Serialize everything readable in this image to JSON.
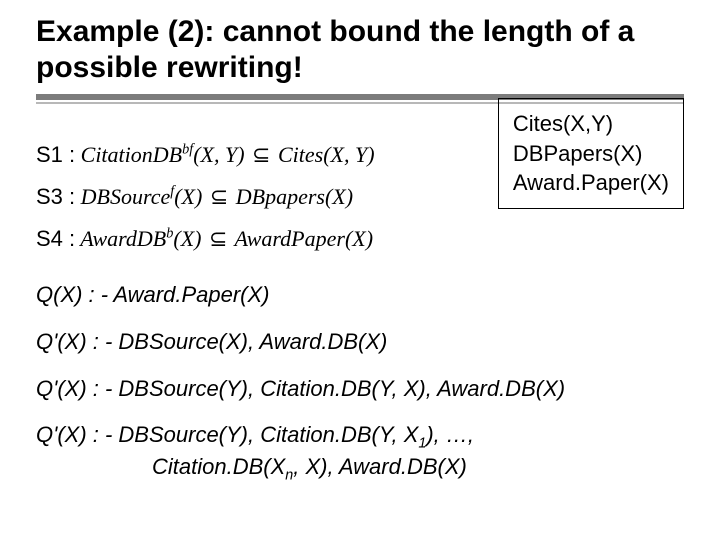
{
  "title": "Example (2): cannot bound the length of a possible rewriting!",
  "schema": {
    "line1": "Cites(X,Y)",
    "line2": "DBPapers(X)",
    "line3": "Award.Paper(X)"
  },
  "rules": {
    "s1": {
      "label": "S1 :",
      "lhs_name": "CitationDB",
      "lhs_sup": "bf",
      "lhs_args": "(X, Y)",
      "rhs": "Cites(X, Y)"
    },
    "s3": {
      "label": "S3 :",
      "lhs_name": "DBSource",
      "lhs_sup": "f",
      "lhs_args": "(X)",
      "rhs": "DBpapers(X)"
    },
    "s4": {
      "label": "S4 :",
      "lhs_name": "AwardDB",
      "lhs_sup": "b",
      "lhs_args": "(X)",
      "rhs": "AwardPaper(X)"
    }
  },
  "queries": {
    "q0": "Q(X) : -  Award.Paper(X)",
    "q1": "Q'(X) : -  DBSource(X), Award.DB(X)",
    "q2": "Q'(X) : -  DBSource(Y), Citation.DB(Y, X), Award.DB(X)",
    "q3_part1": "Q'(X) : -  DBSource(Y), Citation.DB(Y, X",
    "q3_sub1": "1",
    "q3_part2": "), …,",
    "q3_part3": "Citation.DB(X",
    "q3_subn": "n",
    "q3_part4": ", X),  Award.DB(X)"
  },
  "subset_symbol": "⊆"
}
